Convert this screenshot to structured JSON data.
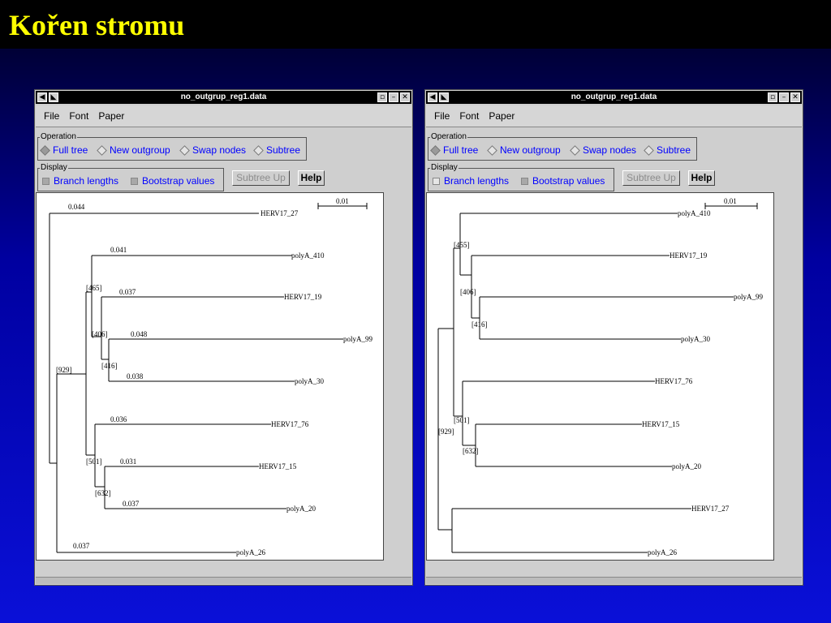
{
  "slide": {
    "title": "Kořen stromu"
  },
  "windows": [
    {
      "title": "no_outgrup_reg1.data",
      "menu": [
        "File",
        "Font",
        "Paper"
      ],
      "operation_legend": "Operation",
      "operations": [
        {
          "label": "Full tree",
          "selected": true
        },
        {
          "label": "New outgroup",
          "selected": false
        },
        {
          "label": "Swap nodes",
          "selected": false
        },
        {
          "label": "Subtree",
          "selected": false
        }
      ],
      "display_legend": "Display",
      "display": [
        {
          "label": "Branch lengths",
          "checked": true
        },
        {
          "label": "Bootstrap values",
          "checked": true
        }
      ],
      "subtree_up_label": "Subtree Up",
      "help_label": "Help",
      "scale_label": "0.01",
      "leaves": [
        "HERV17_27",
        "polyA_410",
        "HERV17_19",
        "polyA_99",
        "polyA_30",
        "HERV17_76",
        "HERV17_15",
        "polyA_20",
        "polyA_26"
      ],
      "branch_lengths": [
        "0.044",
        "0.041",
        "0.037",
        "0.048",
        "0.038",
        "0.036",
        "0.031",
        "0.037",
        "0.037"
      ],
      "bootstraps": [
        "[929]",
        "[465]",
        "[406]",
        "[416]",
        "[501]",
        "[632]"
      ]
    },
    {
      "title": "no_outgrup_reg1.data",
      "menu": [
        "File",
        "Font",
        "Paper"
      ],
      "operation_legend": "Operation",
      "operations": [
        {
          "label": "Full tree",
          "selected": true
        },
        {
          "label": "New outgroup",
          "selected": false
        },
        {
          "label": "Swap nodes",
          "selected": false
        },
        {
          "label": "Subtree",
          "selected": false
        }
      ],
      "display_legend": "Display",
      "display": [
        {
          "label": "Branch lengths",
          "checked": false
        },
        {
          "label": "Bootstrap values",
          "checked": true
        }
      ],
      "subtree_up_label": "Subtree Up",
      "help_label": "Help",
      "scale_label": "0.01",
      "leaves": [
        "polyA_410",
        "HERV17_19",
        "polyA_99",
        "polyA_30",
        "HERV17_76",
        "HERV17_15",
        "polyA_20",
        "HERV17_27",
        "polyA_26"
      ],
      "bootstraps": [
        "[455]",
        "[406]",
        "[416]",
        "[501]",
        "[929]",
        "[632]"
      ]
    }
  ]
}
